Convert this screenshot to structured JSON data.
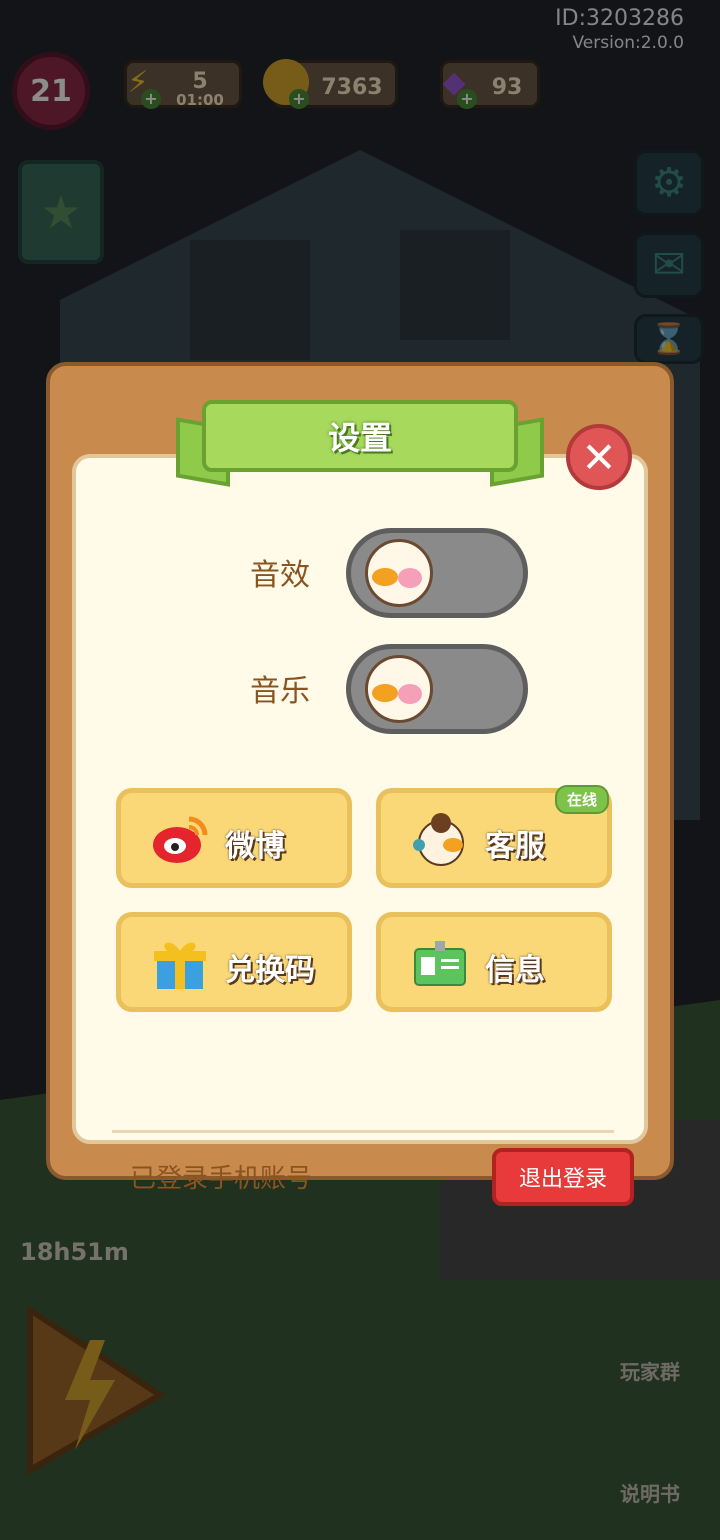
{
  "hud": {
    "id_text": "ID:3203286",
    "version_text": "Version:2.0.0",
    "level": "21",
    "energy": "5",
    "energy_timer": "01:00",
    "coins": "7363",
    "gems": "93"
  },
  "background": {
    "energy_timer": "18h51m",
    "player_group": "玩家群",
    "manual": "说明书"
  },
  "dialog": {
    "title": "设置",
    "sound_effects_label": "音效",
    "music_label": "音乐",
    "sound_effects_on": false,
    "music_on": false,
    "buttons": {
      "weibo": "微博",
      "support": "客服",
      "support_badge": "在线",
      "redeem": "兑换码",
      "info": "信息"
    },
    "account_text": "已登录手机账号",
    "logout_label": "退出登录"
  },
  "colors": {
    "dialog_border": "#c98a4e",
    "title_green": "#a6d95c",
    "tile_yellow": "#fbd877",
    "logout_red": "#e83a3a"
  }
}
